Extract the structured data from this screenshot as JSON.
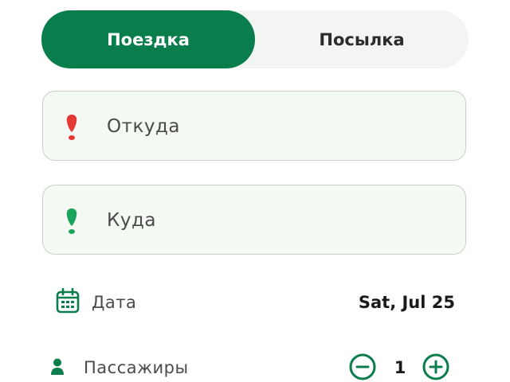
{
  "tabs": {
    "ride_label": "Поездка",
    "parcel_label": "Посылка",
    "active": "ride"
  },
  "route": {
    "from_placeholder": "Откуда",
    "to_placeholder": "Куда",
    "from_icon": "location-pin-red-icon",
    "to_icon": "location-pin-green-icon"
  },
  "date": {
    "label": "Дата",
    "value": "Sat, Jul 25",
    "icon": "calendar-icon"
  },
  "passengers": {
    "label": "Пассажиры",
    "count": "1",
    "icon": "person-icon"
  },
  "colors": {
    "primary": "#0a7d4d",
    "pin_red": "#e53935",
    "pin_green": "#1aa35a",
    "field_bg": "#f5f9f3",
    "segment_bg": "#f3f5f2"
  }
}
